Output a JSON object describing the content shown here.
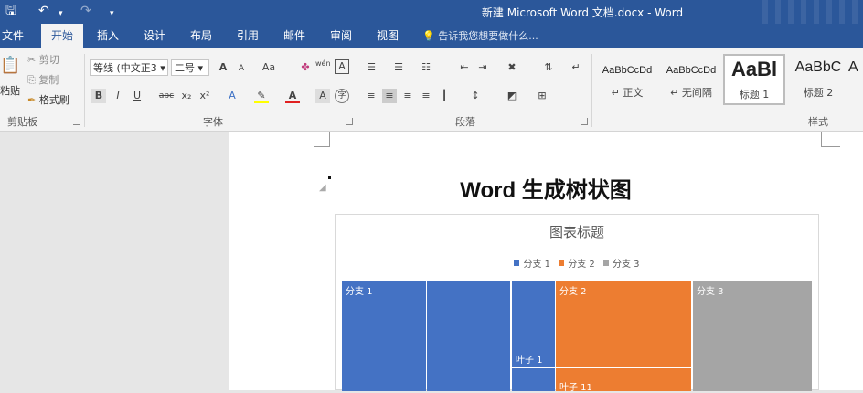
{
  "titlebar": {
    "save_icon": "save-icon",
    "undo_icon": "undo-icon",
    "redo_icon": "redo-icon",
    "title": "新建 Microsoft Word 文档.docx - Word"
  },
  "tabs": [
    {
      "label": "文件"
    },
    {
      "label": "开始"
    },
    {
      "label": "插入"
    },
    {
      "label": "设计"
    },
    {
      "label": "布局"
    },
    {
      "label": "引用"
    },
    {
      "label": "邮件"
    },
    {
      "label": "审阅"
    },
    {
      "label": "视图"
    }
  ],
  "active_tab": "开始",
  "tell_me": "告诉我您想要做什么...",
  "clipboard": {
    "paste": "粘贴",
    "cut": "剪切",
    "copy": "复制",
    "format_painter": "格式刷",
    "group": "剪贴板"
  },
  "font": {
    "name": "等线 (中文正3",
    "size": "二号",
    "group": "字体",
    "grow": "A",
    "shrink": "A",
    "case": "Aa",
    "bold": "B",
    "italic": "I",
    "underline": "U",
    "strike": "abc",
    "subscript": "x₂",
    "superscript": "x²",
    "phonetic": "wén",
    "border_char": "A"
  },
  "paragraph": {
    "group": "段落"
  },
  "styles": {
    "group": "样式",
    "items": [
      {
        "preview": "AaBbCcDd",
        "label": "正文"
      },
      {
        "preview": "AaBbCcDd",
        "label": "无间隔"
      },
      {
        "preview": "AaBl",
        "label": "标题 1"
      },
      {
        "preview": "AaBbC",
        "label": "标题 2"
      },
      {
        "preview": "A",
        "label": ""
      }
    ]
  },
  "document": {
    "title": "Word 生成树状图"
  },
  "colors": {
    "accent": "#2b579a",
    "branch1": "#4472c4",
    "branch2": "#ed7d31",
    "branch3": "#a5a5a5"
  },
  "chart_data": {
    "type": "treemap",
    "title": "图表标题",
    "legend": [
      "分支 1",
      "分支 2",
      "分支 3"
    ],
    "legend_position": "top",
    "visible_labels": [
      "分支 1",
      "分支 2",
      "分支 3",
      "叶子 1",
      "叶子 11"
    ]
  }
}
